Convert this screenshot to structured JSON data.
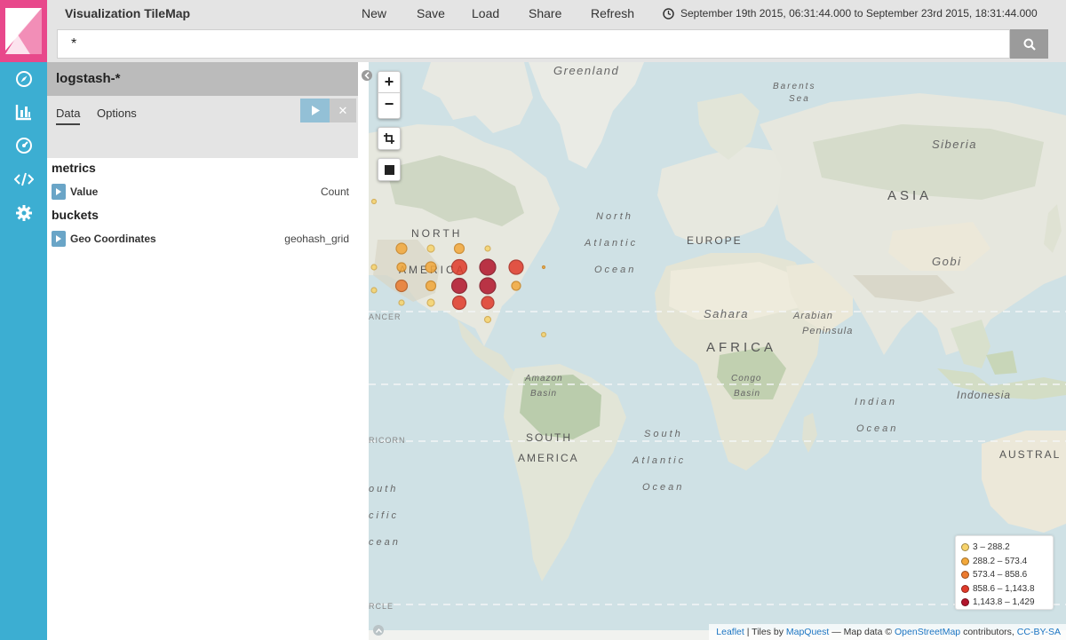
{
  "header": {
    "title": "Visualization TileMap",
    "actions": {
      "new": "New",
      "save": "Save",
      "load": "Load",
      "share": "Share",
      "refresh": "Refresh"
    },
    "time_range": "September 19th 2015, 06:31:44.000 to September 23rd 2015, 18:31:44.000"
  },
  "search": {
    "query": "*"
  },
  "nav": {
    "icons": [
      "discover-icon",
      "visualize-icon",
      "dashboard-icon",
      "dev-tools-icon",
      "settings-icon"
    ]
  },
  "sidebar": {
    "index_pattern": "logstash-*",
    "tabs": {
      "data": "Data",
      "options": "Options"
    },
    "metrics": {
      "title": "metrics",
      "items": [
        {
          "label": "Value",
          "value": "Count"
        }
      ]
    },
    "buckets": {
      "title": "buckets",
      "items": [
        {
          "label": "Geo Coordinates",
          "value": "geohash_grid"
        }
      ]
    }
  },
  "map": {
    "zoom_in": "+",
    "zoom_out": "−",
    "labels": {
      "greenland": "Greenland",
      "barents_1": "Barents",
      "barents_2": "Sea",
      "siberia": "Siberia",
      "asia": "ASIA",
      "north_label": "NORTH",
      "america_label": "AMERICA",
      "atlantic_n_1": "North",
      "atlantic_n_2": "Atlantic",
      "atlantic_n_3": "Ocean",
      "europe": "EUROPE",
      "gobi": "Gobi",
      "sahara": "Sahara",
      "arabian_1": "Arabian",
      "arabian_2": "Peninsula",
      "africa": "AFRICA",
      "amazon_1": "Amazon",
      "amazon_2": "Basin",
      "congo_1": "Congo",
      "congo_2": "Basin",
      "indonesia": "Indonesia",
      "indian_1": "Indian",
      "indian_2": "Ocean",
      "south_america_1": "SOUTH",
      "south_america_2": "AMERICA",
      "atlantic_s_1": "South",
      "atlantic_s_2": "Atlantic",
      "atlantic_s_3": "Ocean",
      "australia": "AUSTRAL",
      "cancer": "ANCER",
      "capricorn": "RICORN",
      "pacific_1": "outh",
      "pacific_2": "cific",
      "pacific_3": "cean",
      "circle": "RCLE"
    },
    "legend": [
      {
        "label": "3 – 288.2",
        "color": "#f7d36b"
      },
      {
        "label": "288.2 – 573.4",
        "color": "#f3a83b"
      },
      {
        "label": "573.4 – 858.6",
        "color": "#ec7a2e"
      },
      {
        "label": "858.6 – 1,143.8",
        "color": "#e03a2a"
      },
      {
        "label": "1,143.8 – 1,429",
        "color": "#b2142b"
      }
    ],
    "attribution": {
      "leaflet": "Leaflet",
      "sep1": " | Tiles by ",
      "mapquest": "MapQuest",
      "sep2": " — Map data © ",
      "osm": "OpenStreetMap",
      "sep3": " contributors, ",
      "license": "CC-BY-SA"
    }
  }
}
